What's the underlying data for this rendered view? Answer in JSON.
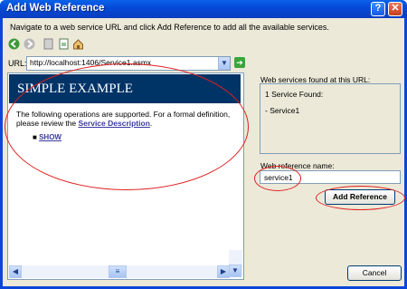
{
  "window": {
    "title": "Add Web Reference"
  },
  "instructions": "Navigate to a web service URL and click Add Reference to add all the available services.",
  "toolbar_icons": [
    "back-icon",
    "forward-icon",
    "stop-icon",
    "refresh-icon",
    "home-icon"
  ],
  "url": {
    "label": "URL:",
    "value": "http://localhost:1406/Service1.asmx"
  },
  "page": {
    "banner": "SIMPLE EXAMPLE",
    "text_before": "The following operations are supported. For a formal definition, please review the ",
    "link": "Service Description",
    "text_after": ".",
    "operations": [
      "SHOW"
    ]
  },
  "services_found": {
    "label": "Web services found at this URL:",
    "count_text": "1 Service Found:",
    "item": "- Service1"
  },
  "reference_name": {
    "label": "Web reference name:",
    "value": "service1"
  },
  "buttons": {
    "add": "Add Reference",
    "cancel": "Cancel"
  },
  "colors": {
    "banner": "#003366",
    "annotation": "#e02020",
    "titlebar": "#0a50dc"
  }
}
